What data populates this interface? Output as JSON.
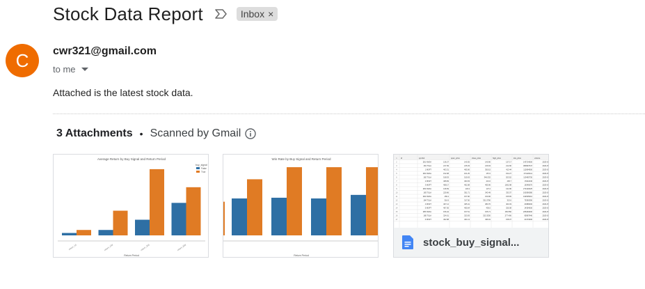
{
  "subject": "Stock Data Report",
  "label": "Inbox",
  "label_close": "×",
  "sender": {
    "avatar_letter": "C",
    "email": "cwr321@gmail.com",
    "to": "to me"
  },
  "body": "Attached is the latest stock data.",
  "attachments": {
    "count_label": "3 Attachments",
    "separator": "•",
    "scanned_label": "Scanned by Gmail",
    "items": [
      {
        "kind": "chart-image",
        "chart_data": {
          "type": "bar",
          "title": "Average Return by Buy Signal and Return Period",
          "xlabel": "Return Period",
          "ylabel": "",
          "categories": [
            "return_1d",
            "return_10d",
            "return_30d",
            "return_60d"
          ],
          "legend_title": "buy_signal",
          "legend_position": "top-right",
          "series": [
            {
              "name": "False",
              "color": "#2e6fa4",
              "values": [
                0.4,
                0.9,
                2.6,
                5.4
              ]
            },
            {
              "name": "True",
              "color": "#e07b24",
              "values": [
                0.9,
                4.1,
                11.0,
                8.0
              ]
            }
          ],
          "ylim": [
            0,
            11.8
          ]
        }
      },
      {
        "kind": "chart-image",
        "chart_data": {
          "type": "bar",
          "title": "Win Rate by Buy Signal and Return Period",
          "xlabel": "Return Period",
          "ylabel": "",
          "categories": [
            "",
            "",
            "",
            ""
          ],
          "series": [
            {
              "name": "",
              "color": "#2e6fa4",
              "values": [
                0.52,
                0.53,
                0.52,
                0.57
              ]
            },
            {
              "name": "",
              "color": "#e07b24",
              "values": [
                0.79,
                0.96,
                0.96,
                0.96
              ]
            }
          ],
          "ylim": [
            0,
            1.0
          ]
        }
      },
      {
        "kind": "spreadsheet",
        "file_name": "stock_buy_signal...",
        "table": {
          "headers": [
            "id",
            "symbol",
            "open_price",
            "close_price",
            "high_price",
            "low_price",
            "volume",
            "date"
          ],
          "rows": [
            [
              "281",
              "NVDA",
              "136.27",
              "140.35",
              "140.96",
              "137.17",
              "143714000",
              "2023-05"
            ],
            [
              "181",
              "TSLA",
              "217.99",
              "215.33",
              "216.63",
              "212.90",
              "380697647",
              "2023-05"
            ],
            [
              "1",
              "MSFT",
              "403.31",
              "405.06",
              "350.15",
              "413.44",
              "112694500",
              "2023-05"
            ],
            [
              "282",
              "NVDA",
              "152.08",
              "161.25",
              "157.0",
              "152.27",
              "171220111",
              "2023-05"
            ],
            [
              "182",
              "TSLA",
              "518.53",
              "515.63",
              "346.532",
              "523.52",
              "113465730",
              "2023-05"
            ],
            [
              "2",
              "MSFT",
              "408.99",
              "403.03",
              "413.0",
              "406.7",
              "15111640",
              "2023-05"
            ],
            [
              "3",
              "MSFT",
              "408.17",
              "402.08",
              "405.96",
              "1002.98",
              "16345070",
              "2023-05"
            ],
            [
              "283",
              "NVDA",
              "136.59",
              "133.3",
              "137.2",
              "131.86",
              "273140025",
              "2023-05"
            ],
            [
              "183",
              "TSLA",
              "229.96",
              "351.71",
              "343.49",
              "333.37",
              "190396380",
              "2023-05"
            ],
            [
              "284",
              "NVDA",
              "156.4",
              "157.90",
              "150.96",
              "155.65",
              "194505010",
              "2023-05"
            ],
            [
              "184",
              "TSLA",
              "316.9",
              "317.50",
              "321.5790",
              "313.6",
              "75390390",
              "2023-05"
            ],
            [
              "4",
              "MSFT",
              "407.14",
              "405.41",
              "383.70",
              "403.33",
              "20389000",
              "2023-05"
            ],
            [
              "5",
              "MSFT",
              "407.05",
              "405.64",
              "430.0",
              "325.38",
              "14354000",
              "2023-05"
            ],
            [
              "285",
              "NVDA",
              "156.34",
              "157.51",
              "155.71",
              "150.550",
              "205293000",
              "2023-05"
            ],
            [
              "185",
              "TSLA",
              "324.01",
              "323.93",
              "323.3330",
              "277.406",
              "95997940",
              "2023-05"
            ],
            [
              "6",
              "MSFT",
              "402.98",
              "401.13",
              "496.91",
              "158.37",
              "21373000",
              "2023-05"
            ]
          ]
        }
      }
    ]
  },
  "colors": {
    "avatar": "#ef6c00",
    "bar_false": "#2e6fa4",
    "bar_true": "#e07b24",
    "doc_icon": "#4285f4"
  }
}
